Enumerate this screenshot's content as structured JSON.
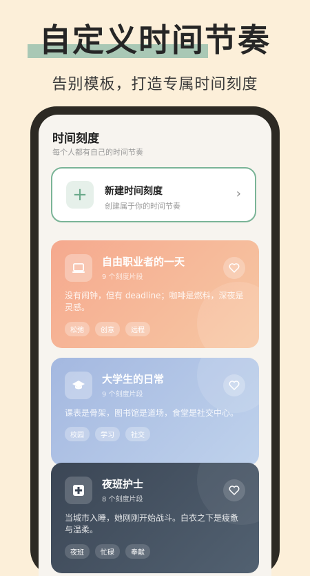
{
  "promo": {
    "title": "自定义时间节奏",
    "subtitle": "告别模板，打造专属时间刻度"
  },
  "screen": {
    "title": "时间刻度",
    "subtitle": "每个人都有自己的时间节奏"
  },
  "new_card": {
    "title": "新建时间刻度",
    "subtitle": "创建属于你的时间节奏"
  },
  "cards": [
    {
      "title": "自由职业者的一天",
      "count": "9 个刻度片段",
      "desc": "没有闹钟，但有 deadline；咖啡是燃料，深夜是灵感。",
      "tags": [
        "松弛",
        "创意",
        "远程"
      ],
      "icon": "laptop-icon"
    },
    {
      "title": "大学生的日常",
      "count": "9 个刻度片段",
      "desc": "课表是骨架，图书馆是道场，食堂是社交中心。",
      "tags": [
        "校园",
        "学习",
        "社交"
      ],
      "icon": "graduation-cap-icon"
    },
    {
      "title": "夜班护士",
      "count": "8 个刻度片段",
      "desc": "当城市入睡，她刚刚开始战斗。白衣之下是疲惫与温柔。",
      "tags": [
        "夜班",
        "忙碌",
        "奉献"
      ],
      "icon": "medical-cross-icon"
    }
  ],
  "colors": {
    "background": "#fcefd9",
    "accent_green": "#7ab497",
    "card_orange": "#f5a98e",
    "card_blue": "#a4b8e0",
    "card_dark": "#3b4655"
  }
}
